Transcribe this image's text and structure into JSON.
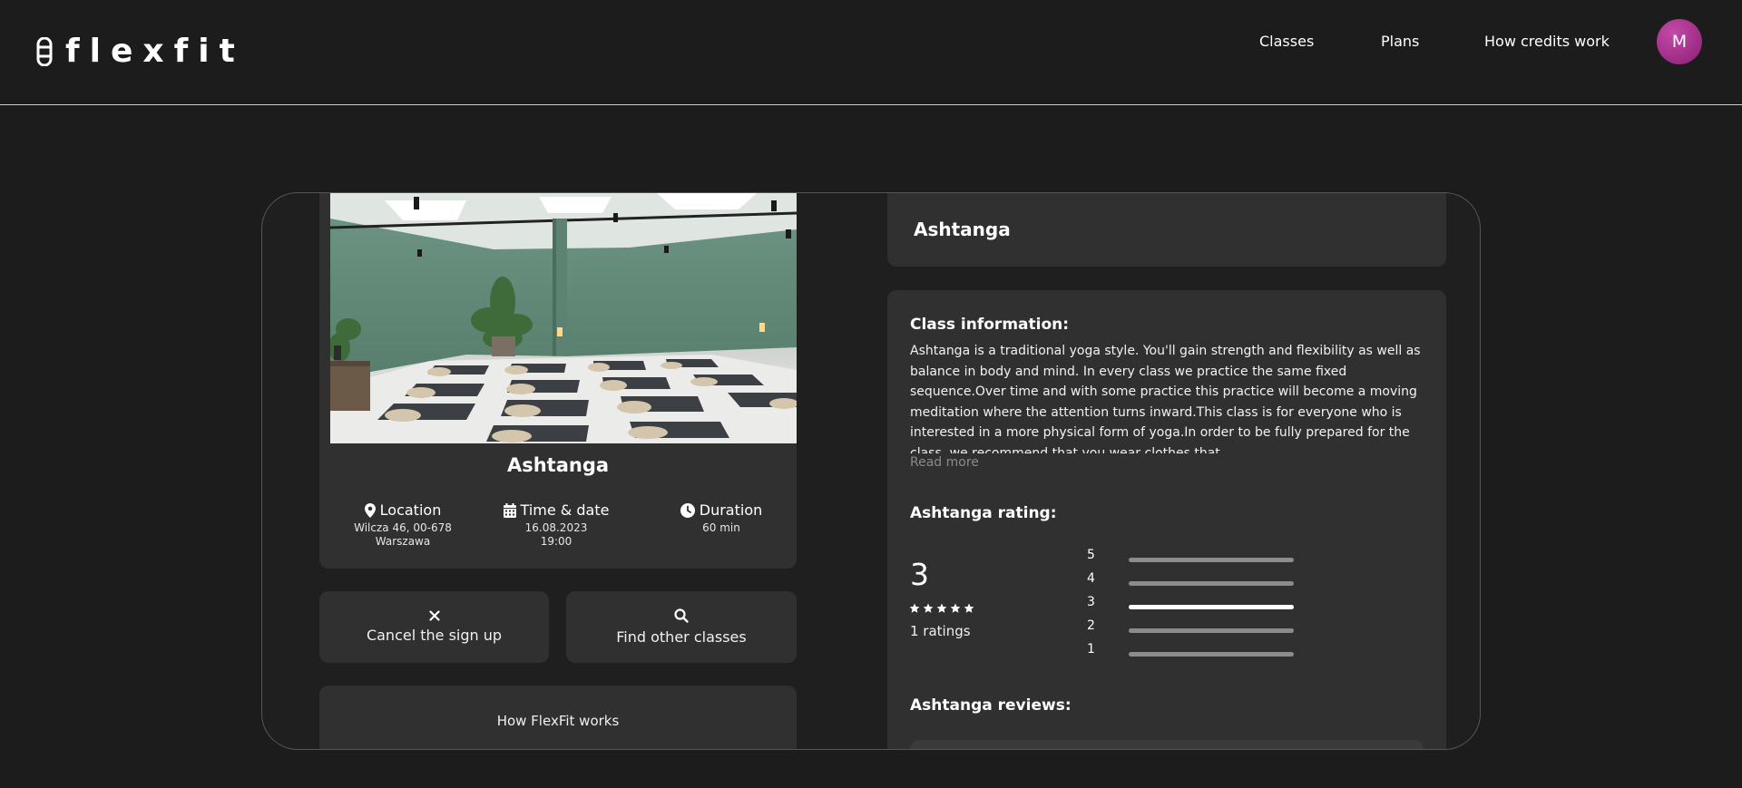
{
  "header": {
    "logo_text": "flexfit",
    "nav": [
      {
        "label": "Classes"
      },
      {
        "label": "Plans"
      },
      {
        "label": "How credits work"
      }
    ],
    "avatar_initial": "M",
    "avatar_color": "#a3288a"
  },
  "summary": {
    "title": "Ashtanga",
    "location": {
      "label": "Location",
      "icon": "map-pin-icon",
      "line1": "Wilcza 46, 00-678",
      "line2": "Warszawa"
    },
    "time_date": {
      "label": "Time & date",
      "icon": "calendar-icon",
      "date": "16.08.2023",
      "time": "19:00"
    },
    "duration": {
      "label": "Duration",
      "icon": "clock-icon",
      "value": "60 min"
    }
  },
  "actions": {
    "cancel": {
      "label": "Cancel the sign up",
      "icon": "close-icon"
    },
    "find": {
      "label": "Find other classes",
      "icon": "search-icon"
    }
  },
  "how_it_works": {
    "label": "How FlexFit works"
  },
  "details": {
    "title": "Ashtanga",
    "info_heading": "Class information:",
    "description": "Ashtanga is a traditional yoga style. You'll gain strength and flexibility as well as balance in body and mind. In every class we practice the same fixed sequence.Over time and with some practice this practice will become a moving meditation where the attention turns inward.This class is for everyone who is interested in a more physical form of yoga.In order to be fully prepared for the class, we recommend that you wear clothes that",
    "read_more": "Read more",
    "rating_heading": "Ashtanga rating:",
    "rating_value": "3",
    "stars": 5,
    "ratings_count": "1 ratings",
    "breakdown": [
      {
        "label": "5",
        "fraction": 0
      },
      {
        "label": "4",
        "fraction": 0
      },
      {
        "label": "3",
        "fraction": 1
      },
      {
        "label": "2",
        "fraction": 0
      },
      {
        "label": "1",
        "fraction": 0
      }
    ],
    "reviews_heading": "Ashtanga reviews:"
  },
  "colors": {
    "background": "#1c1c1c",
    "panel": "#303030",
    "bar_track": "#8c8c8c",
    "bar_fill": "#ffffff",
    "muted_text": "#8a8a8a"
  }
}
